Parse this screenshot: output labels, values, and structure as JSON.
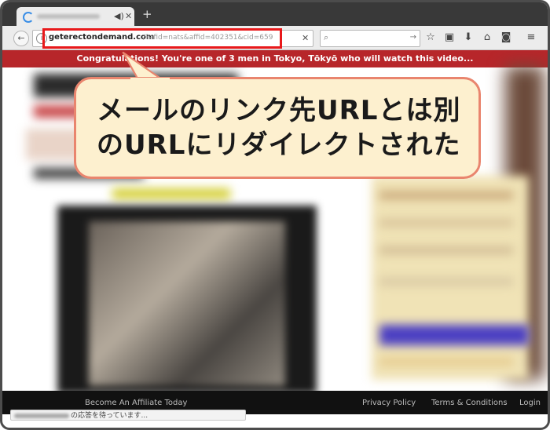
{
  "browser": {
    "tab": {
      "audio_icon": "speaker-icon",
      "close_icon": "close-icon"
    },
    "new_tab_icon": "plus-icon",
    "nav": {
      "back_icon": "back-arrow-icon",
      "url_domain": "geterectondemand.com",
      "url_query": "/?afid=nats&affid=402351&cid=659",
      "search_icon": "search-icon",
      "toolbar_icons": [
        "star-icon",
        "library-icon",
        "download-icon",
        "home-icon",
        "pocket-icon",
        "menu-icon"
      ]
    }
  },
  "page": {
    "banner": "Congratulations! You're one of 3 men in Tokyo, Tōkyō who will watch this video...",
    "footer": {
      "affiliate": "Become An Affiliate Today",
      "privacy": "Privacy Policy",
      "terms": "Terms & Conditions",
      "login": "Login"
    }
  },
  "callout": {
    "line1": "メールのリンク先URLとは別",
    "line2": "のURLにリダイレクトされた"
  },
  "status": {
    "text": "の応答を待っています..."
  },
  "colors": {
    "highlight": "#e8191b",
    "banner": "#b7262a",
    "callout_bg": "#fdf0cf",
    "callout_border": "#e9856e"
  }
}
